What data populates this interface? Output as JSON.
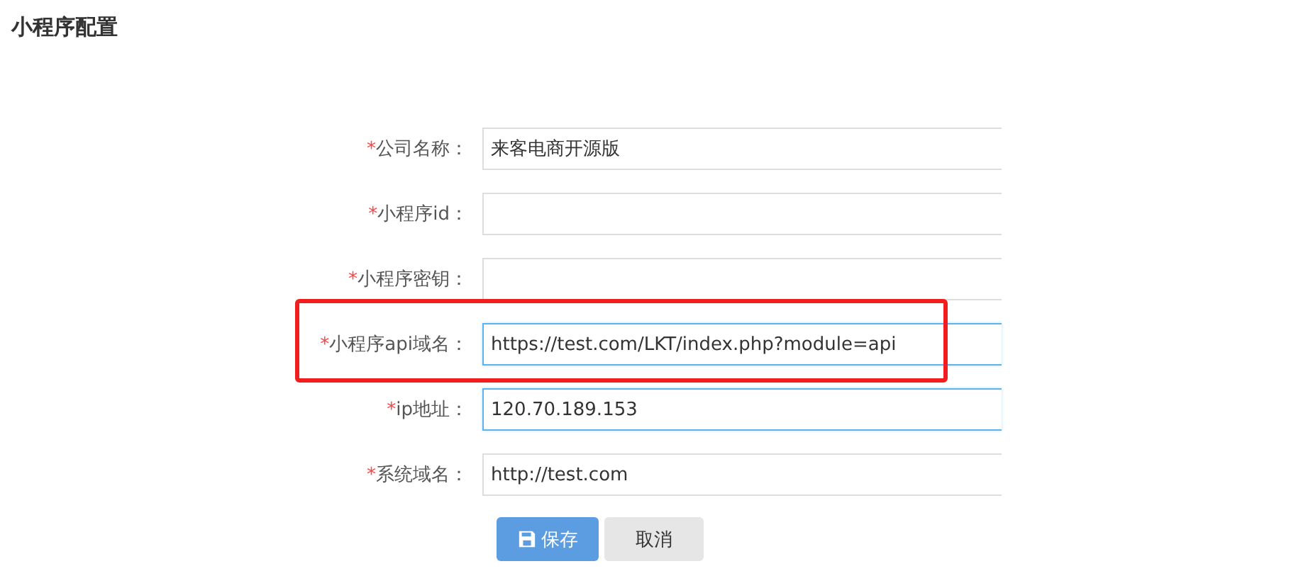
{
  "page_title": "小程序配置",
  "fields": [
    {
      "label": "公司名称：",
      "required_mark": "*",
      "value": "来客电商开源版",
      "focused": false,
      "highlighted": false
    },
    {
      "label": "小程序id：",
      "required_mark": "*",
      "focused": false,
      "highlighted": false
    },
    {
      "label": "小程序密钥：",
      "required_mark": "*",
      "focused": false,
      "highlighted": false
    },
    {
      "label": "小程序api域名：",
      "required_mark": "*",
      "value": "https://test.com/LKT/index.php?module=api",
      "focused": true,
      "highlighted": true
    },
    {
      "label": "ip地址：",
      "required_mark": "*",
      "value": "120.70.189.153",
      "focused": true,
      "highlighted": false
    },
    {
      "label": "系统域名：",
      "required_mark": "*",
      "value": "http://test.com",
      "focused": false,
      "highlighted": false
    }
  ],
  "buttons": [
    {
      "label": "保存",
      "kind": "primary"
    },
    {
      "label": "取消",
      "kind": "secondary"
    }
  ]
}
